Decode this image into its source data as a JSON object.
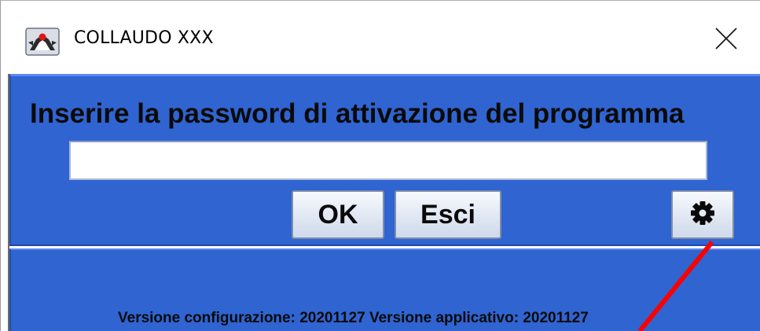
{
  "window": {
    "title": "COLLAUDO XXX",
    "app_icon": "java-duke-icon",
    "close_icon": "close-icon"
  },
  "login": {
    "prompt": "Inserire la password di attivazione del programma",
    "password_value": "",
    "ok_label": "OK",
    "cancel_label": "Esci",
    "settings_icon": "gear-icon"
  },
  "footer": {
    "version_text": "Versione configurazione: 20201127 Versione applicativo: 20201127"
  },
  "colors": {
    "panel_background": "#2f64d1",
    "annotation_arrow": "#ff0000",
    "titlebar_background": "#ffffff"
  }
}
